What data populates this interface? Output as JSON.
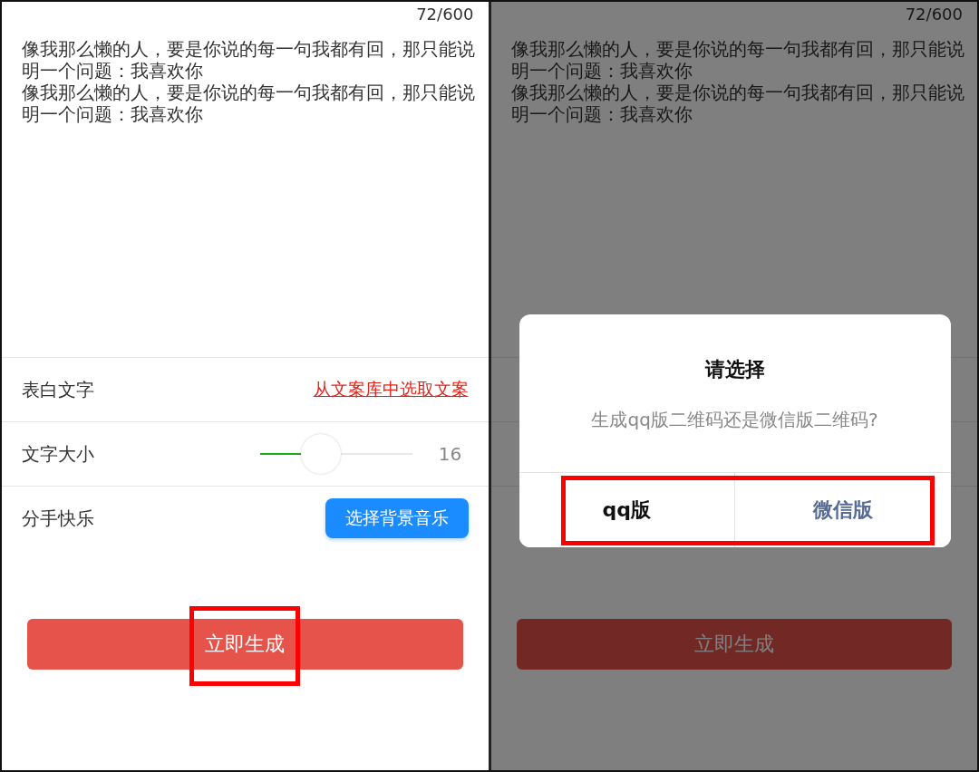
{
  "screens": [
    {
      "counter": "72/600",
      "messages": [
        "像我那么懒的人，要是你说的每一句我都有回，那只能说明一个问题：我喜欢你",
        "像我那么懒的人，要是你说的每一句我都有回，那只能说明一个问题：我喜欢你"
      ],
      "rows": [
        {
          "kind": "link",
          "label": "表白文字",
          "link": "从文案库中选取文案"
        },
        {
          "kind": "slider",
          "label": "文字大小",
          "level": 0.4,
          "reading": "16"
        },
        {
          "kind": "button",
          "label": "分手快乐",
          "button": "选择背景音乐"
        }
      ],
      "generate_button": {
        "label": "立即生成",
        "highlighted": true
      }
    },
    {
      "counter": "72/600",
      "messages": [
        "像我那么懒的人，要是你说的每一句我都有回，那只能说明一个问题：我喜欢你",
        "像我那么懒的人，要是你说的每一句我都有回，那只能说明一个问题：我喜欢你"
      ],
      "generate_button": {
        "label": "立即生成",
        "highlighted": false
      },
      "dialog": {
        "title": "请选择",
        "message": "生成qq版二维码还是微信版二维码?",
        "actions_highlighted": true,
        "actions": [
          {
            "label": "qq版",
            "kind": "default"
          },
          {
            "label": "微信版",
            "kind": "primary"
          }
        ]
      }
    }
  ]
}
